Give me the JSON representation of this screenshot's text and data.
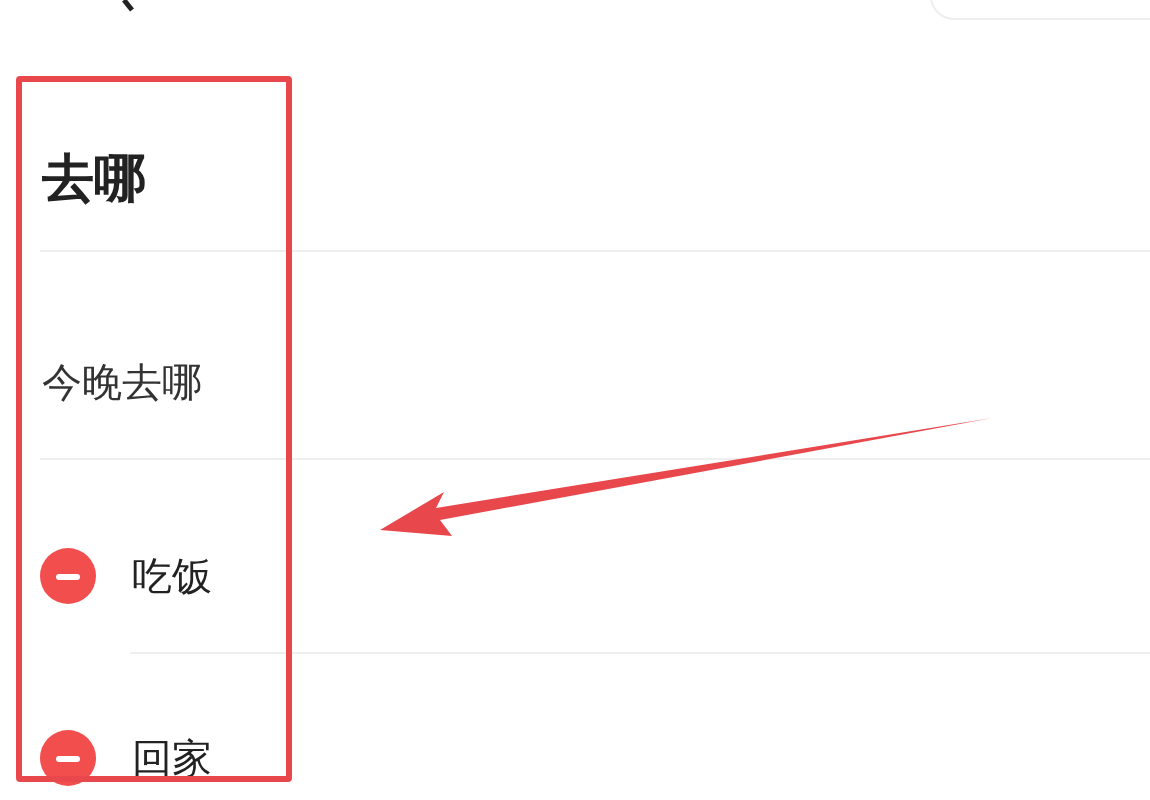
{
  "title": "去哪",
  "subtitle": "今晚去哪",
  "items": [
    {
      "label": "吃饭"
    },
    {
      "label": "回家"
    }
  ]
}
